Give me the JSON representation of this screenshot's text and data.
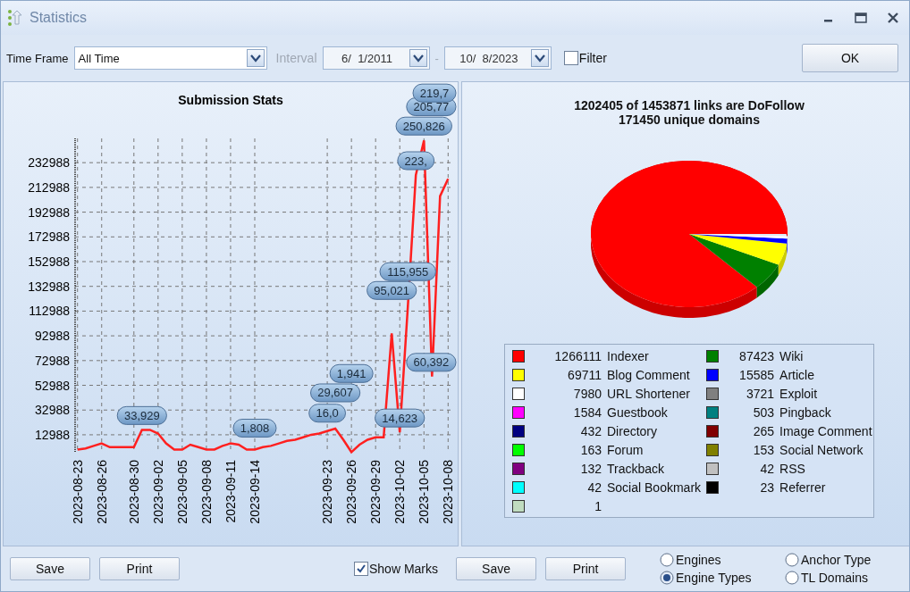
{
  "window": {
    "title": "Statistics"
  },
  "toolbar": {
    "time_frame_label": "Time Frame",
    "time_frame": "All Time",
    "interval_label": "Interval",
    "interval_disabled": true,
    "date_from": "6/  1/2011",
    "separator": "-",
    "date_to": "10/  8/2023",
    "filter": {
      "label": "Filter",
      "checked": false
    },
    "ok": "OK"
  },
  "left_panel": {
    "chart_data": {
      "type": "line",
      "title": "Submission Stats",
      "categories": [
        "2023-08-23",
        null,
        null,
        "2023-08-26",
        null,
        null,
        null,
        "2023-08-30",
        null,
        null,
        "2023-09-02",
        null,
        null,
        "2023-09-05",
        null,
        null,
        "2023-09-08",
        null,
        null,
        "2023-09-11",
        null,
        null,
        "2023-09-14",
        null,
        null,
        null,
        null,
        null,
        null,
        null,
        null,
        "2023-09-23",
        null,
        null,
        "2023-09-26",
        null,
        null,
        "2023-09-29",
        null,
        null,
        "2023-10-02",
        null,
        null,
        "2023-10-05",
        null,
        null,
        "2023-10-08"
      ],
      "series": [
        {
          "color": "#ff2020",
          "values": [
            1000,
            2000,
            4000,
            6000,
            3000,
            3000,
            3000,
            3000,
            17000,
            17000,
            14000,
            6000,
            1000,
            1000,
            5000,
            3000,
            1000,
            1000,
            4000,
            6000,
            5000,
            1000,
            1000,
            3000,
            4000,
            6000,
            8000,
            9000,
            11000,
            13000,
            14000,
            16000,
            18000,
            9000,
            -1000,
            5000,
            9000,
            11000,
            11000,
            95000,
            15000,
            116000,
            223000,
            251000,
            60000,
            206000,
            220000
          ]
        }
      ],
      "value_labels": [
        null,
        null,
        null,
        null,
        null,
        null,
        null,
        null,
        "33,929",
        null,
        null,
        null,
        null,
        null,
        null,
        null,
        null,
        null,
        null,
        null,
        null,
        null,
        "1,808",
        null,
        null,
        null,
        null,
        null,
        null,
        null,
        null,
        "16,0",
        "29,607",
        null,
        "1,941",
        null,
        null,
        null,
        null,
        "95,021",
        "14,623",
        "115,955",
        "223,",
        "250,826",
        "60,392",
        "205,77",
        "219,7"
      ],
      "grid": true,
      "ylim": [
        -1500,
        252600
      ],
      "yticks": [
        12988,
        32988,
        52988,
        72988,
        92988,
        112988,
        132988,
        152988,
        172988,
        192988,
        212988,
        232988
      ]
    },
    "buttons": [
      "Save",
      "Print"
    ],
    "show_marks": {
      "label": "Show Marks",
      "checked": true
    }
  },
  "right_panel": {
    "title": "1202405 of 1453871 links are DoFollow",
    "subtitle": "171450 unique domains",
    "legend": [
      {
        "count": "1266111",
        "label": "Indexer",
        "color": "#ff0000"
      },
      {
        "count": "87423",
        "label": "Wiki",
        "color": "#008000"
      },
      {
        "count": "69711",
        "label": "Blog Comment",
        "color": "#ffff00"
      },
      {
        "count": "15585",
        "label": "Article",
        "color": "#0000ff"
      },
      {
        "count": "7980",
        "label": "URL Shortener",
        "color": "#ffffff"
      },
      {
        "count": "3721",
        "label": "Exploit",
        "color": "#808080"
      },
      {
        "count": "1584",
        "label": "Guestbook",
        "color": "#ff00ff"
      },
      {
        "count": "503",
        "label": "Pingback",
        "color": "#008080"
      },
      {
        "count": "432",
        "label": "Directory",
        "color": "#000080"
      },
      {
        "count": "265",
        "label": "Image Comment",
        "color": "#800000"
      },
      {
        "count": "163",
        "label": "Forum",
        "color": "#00ff00"
      },
      {
        "count": "153",
        "label": "Social Network",
        "color": "#808000"
      },
      {
        "count": "132",
        "label": "Trackback",
        "color": "#800080"
      },
      {
        "count": "42",
        "label": "RSS",
        "color": "#c0c0c0"
      },
      {
        "count": "42",
        "label": "Social Bookmark",
        "color": "#00ffff"
      },
      {
        "count": "23",
        "label": "Referrer",
        "color": "#000000"
      },
      {
        "count": "1",
        "color": "#c0dcc0"
      }
    ],
    "buttons": [
      "Save",
      "Print"
    ],
    "options": [
      {
        "label": "Engines",
        "selected": false
      },
      {
        "label": "Anchor Type",
        "selected": false
      },
      {
        "label": "Engine Types",
        "selected": true
      },
      {
        "label": "TL Domains",
        "selected": false
      }
    ]
  }
}
